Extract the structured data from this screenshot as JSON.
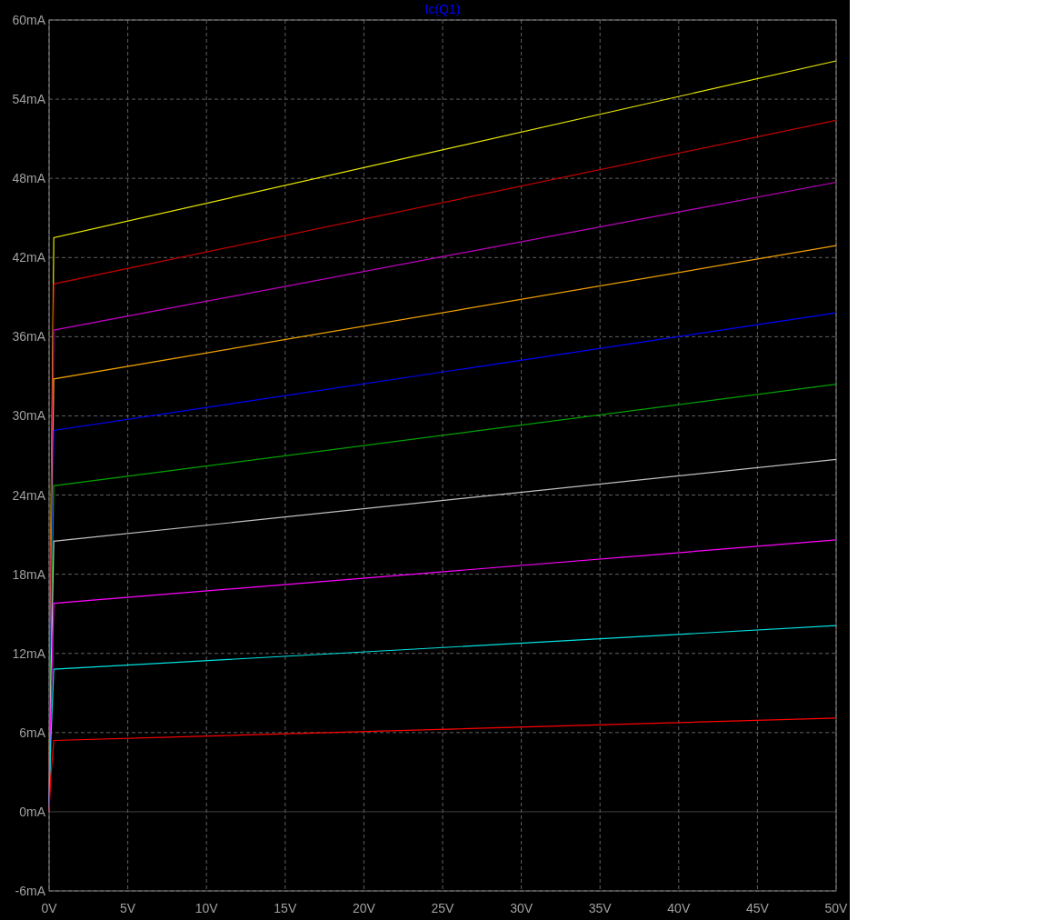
{
  "plot": {
    "chart_data": {
      "type": "line",
      "title": "Ic(Q1)",
      "grid": true,
      "x": [
        0,
        0.1,
        0.3,
        50
      ],
      "xlim": [
        0,
        50
      ],
      "ylim": [
        -6,
        60
      ],
      "xticks": [
        {
          "value": 0,
          "label": "0V"
        },
        {
          "value": 5,
          "label": "5V"
        },
        {
          "value": 10,
          "label": "10V"
        },
        {
          "value": 15,
          "label": "15V"
        },
        {
          "value": 20,
          "label": "20V"
        },
        {
          "value": 25,
          "label": "25V"
        },
        {
          "value": 30,
          "label": "30V"
        },
        {
          "value": 35,
          "label": "35V"
        },
        {
          "value": 40,
          "label": "40V"
        },
        {
          "value": 45,
          "label": "45V"
        },
        {
          "value": 50,
          "label": "50V"
        }
      ],
      "yticks": [
        {
          "value": -6,
          "label": "-6mA"
        },
        {
          "value": 0,
          "label": "0mA"
        },
        {
          "value": 6,
          "label": "6mA"
        },
        {
          "value": 12,
          "label": "12mA"
        },
        {
          "value": 18,
          "label": "18mA"
        },
        {
          "value": 24,
          "label": "24mA"
        },
        {
          "value": 30,
          "label": "30mA"
        },
        {
          "value": 36,
          "label": "36mA"
        },
        {
          "value": 42,
          "label": "42mA"
        },
        {
          "value": 48,
          "label": "48mA"
        },
        {
          "value": 54,
          "label": "54mA"
        },
        {
          "value": 60,
          "label": "60mA"
        }
      ],
      "series": [
        {
          "color": "#e8e800",
          "values": [
            0,
            20,
            43.5,
            56.9
          ]
        },
        {
          "color": "#c00000",
          "values": [
            0,
            18,
            40.0,
            52.4
          ]
        },
        {
          "color": "#c000c0",
          "values": [
            0,
            16,
            36.5,
            47.7
          ]
        },
        {
          "color": "#f0a000",
          "values": [
            0,
            15,
            32.8,
            42.9
          ]
        },
        {
          "color": "#0000ff",
          "values": [
            0,
            13,
            28.9,
            37.8
          ]
        },
        {
          "color": "#00a000",
          "values": [
            0,
            11,
            24.7,
            32.4
          ]
        },
        {
          "color": "#c0c0c0",
          "values": [
            0,
            9,
            20.5,
            26.7
          ]
        },
        {
          "color": "#ff00ff",
          "values": [
            0,
            7,
            15.8,
            20.6
          ]
        },
        {
          "color": "#00e0e0",
          "values": [
            0,
            5,
            10.8,
            14.1
          ]
        },
        {
          "color": "#ff0000",
          "values": [
            0,
            2.5,
            5.4,
            7.1
          ]
        }
      ]
    }
  }
}
